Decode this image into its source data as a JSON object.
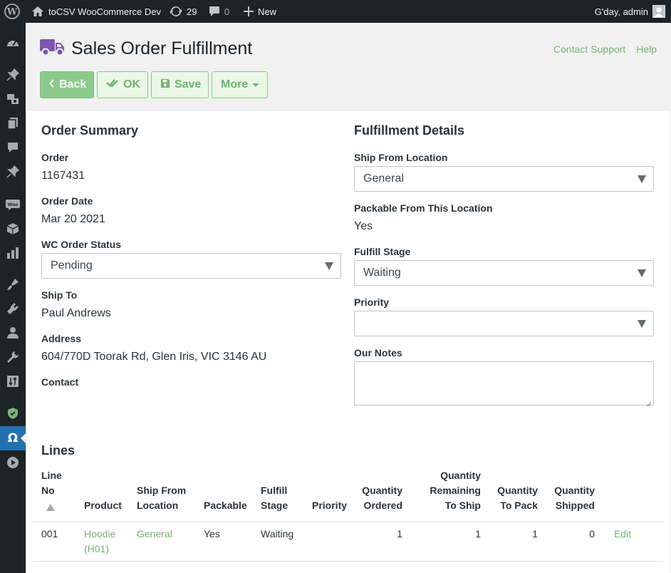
{
  "adminbar": {
    "site_name": "toCSV WooCommerce Dev",
    "updates_count": "29",
    "comments_count": "0",
    "new_label": "New",
    "howdy": "G'day, admin"
  },
  "sidebar": {
    "icons": [
      "dashboard-icon",
      "pin-icon",
      "media-icon",
      "pages-icon",
      "comments-icon",
      "pin-icon",
      "woocommerce-icon",
      "products-icon",
      "analytics-icon",
      "appearance-icon",
      "plugins-icon",
      "users-icon",
      "tools-icon",
      "import-export-icon",
      "security-icon",
      "omega-icon",
      "play-icon"
    ],
    "current": "omega-icon"
  },
  "header": {
    "title": "Sales Order Fulfillment",
    "links": [
      "Contact Support",
      "Help"
    ],
    "buttons": {
      "back": "Back",
      "ok": "OK",
      "save": "Save",
      "more": "More"
    }
  },
  "summary": {
    "title": "Order Summary",
    "order_label": "Order",
    "order_value": "1167431",
    "date_label": "Order Date",
    "date_value": "Mar 20 2021",
    "status_label": "WC Order Status",
    "status_value": "Pending",
    "ship_to_label": "Ship To",
    "ship_to_value": "Paul Andrews",
    "address_label": "Address",
    "address_value": "604/770D Toorak Rd, Glen Iris, VIC 3146 AU",
    "contact_label": "Contact"
  },
  "fulfillment": {
    "title": "Fulfillment Details",
    "ship_from_label": "Ship From Location",
    "ship_from_value": "General",
    "packable_label": "Packable From This Location",
    "packable_value": "Yes",
    "stage_label": "Fulfill Stage",
    "stage_value": "Waiting",
    "priority_label": "Priority",
    "priority_value": "",
    "notes_label": "Our Notes"
  },
  "lines": {
    "title": "Lines",
    "headers": {
      "line_no_1": "Line",
      "line_no_2": "No",
      "product": "Product",
      "ship_from_1": "Ship From",
      "ship_from_2": "Location",
      "packable": "Packable",
      "fulfill_1": "Fulfill",
      "fulfill_2": "Stage",
      "priority": "Priority",
      "qty_ordered_1": "Quantity",
      "qty_ordered_2": "Ordered",
      "qty_remaining_1": "Quantity",
      "qty_remaining_2": "Remaining",
      "qty_remaining_3": "To Ship",
      "qty_pack_1": "Quantity",
      "qty_pack_2": "To Pack",
      "qty_shipped_1": "Quantity",
      "qty_shipped_2": "Shipped"
    },
    "rows": [
      {
        "line_no": "001",
        "product_1": "Hoodie",
        "product_2": "(H01)",
        "ship_from": "General",
        "packable": "Yes",
        "stage": "Waiting",
        "priority": "",
        "qty_ordered": "1",
        "qty_remaining": "1",
        "qty_pack": "1",
        "qty_shipped": "0",
        "action": "Edit"
      }
    ]
  },
  "colors": {
    "accent_green": "#7ab27a",
    "admin_dark": "#1d2327",
    "wp_blue": "#2271b1",
    "title_icon_purple": "#7f54b3"
  }
}
